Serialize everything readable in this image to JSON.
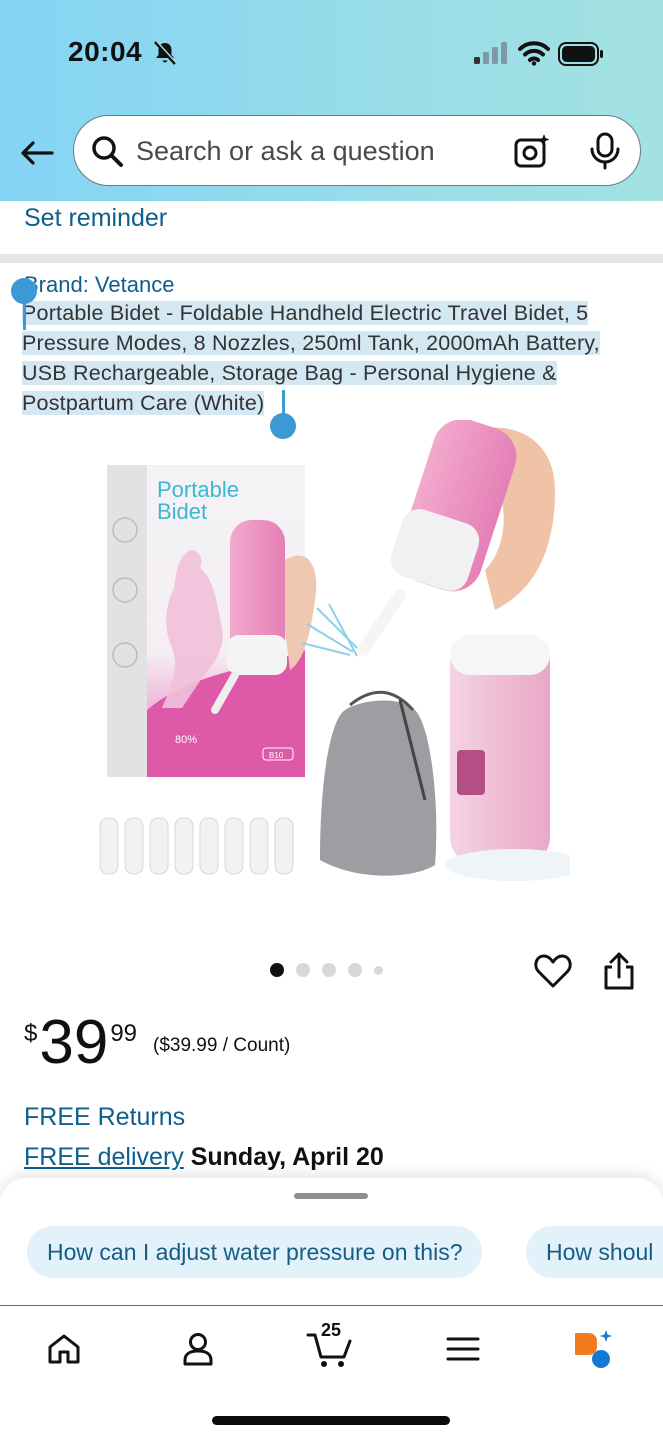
{
  "status_bar": {
    "time": "20:04"
  },
  "search": {
    "placeholder": "Search or ask a question"
  },
  "reminder": {
    "label": "Set reminder"
  },
  "product": {
    "brand": "Brand: Vetance",
    "title": "Portable Bidet - Foldable Handheld Electric Travel Bidet, 5 Pressure Modes, 8 Nozzles, 250ml Tank, 2000mAh Battery, USB Rechargeable, Storage Bag - Personal Hygiene & Postpartum Care (White)",
    "image": {
      "box_text_line1": "Portable",
      "box_text_line2": "Bidet",
      "badge_text": "80%",
      "model_text": "B10"
    },
    "carousel": {
      "total": 5,
      "active_index": 0
    },
    "price": {
      "symbol": "$",
      "whole": "39",
      "fraction": "99",
      "unit_price": "($39.99 / Count)"
    },
    "returns": "FREE Returns",
    "delivery": {
      "link": "FREE delivery",
      "date": "Sunday, April 20"
    }
  },
  "suggestions": [
    "How can I adjust water pressure on this?",
    "How shoul"
  ],
  "nav": {
    "cart_count": "25",
    "items": [
      "home-icon",
      "account-icon",
      "cart-icon",
      "menu-icon",
      "rufus-icon"
    ]
  },
  "colors": {
    "link": "#0e5f8c",
    "selection": "#d3e8f3",
    "chip_bg": "#e3f1fa",
    "header_gradient_start": "#84d4f5",
    "header_gradient_end": "#a3e2e0"
  }
}
